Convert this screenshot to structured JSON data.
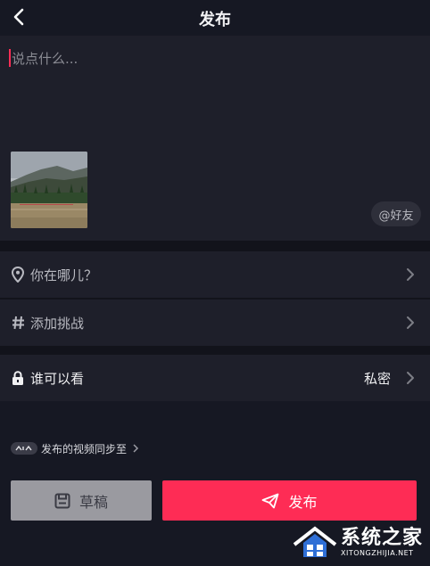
{
  "header": {
    "title": "发布",
    "back_icon": "chevron-left-icon"
  },
  "compose": {
    "placeholder": "说点什么...",
    "mention_label": "@好友",
    "caret_color": "#ff2d55"
  },
  "options": {
    "location_label": "你在哪儿？",
    "challenge_label": "添加挑战",
    "privacy_label": "谁可以看",
    "privacy_value": "私密"
  },
  "sync": {
    "label": "发布的视频同步至"
  },
  "actions": {
    "draft_label": "草稿",
    "publish_label": "发布"
  },
  "colors": {
    "accent": "#fe2c55",
    "background": "#161823",
    "panel": "#1e1f2a"
  },
  "watermark": {
    "main": "系统之家",
    "sub": "XITONGZHIJIA.NET"
  }
}
